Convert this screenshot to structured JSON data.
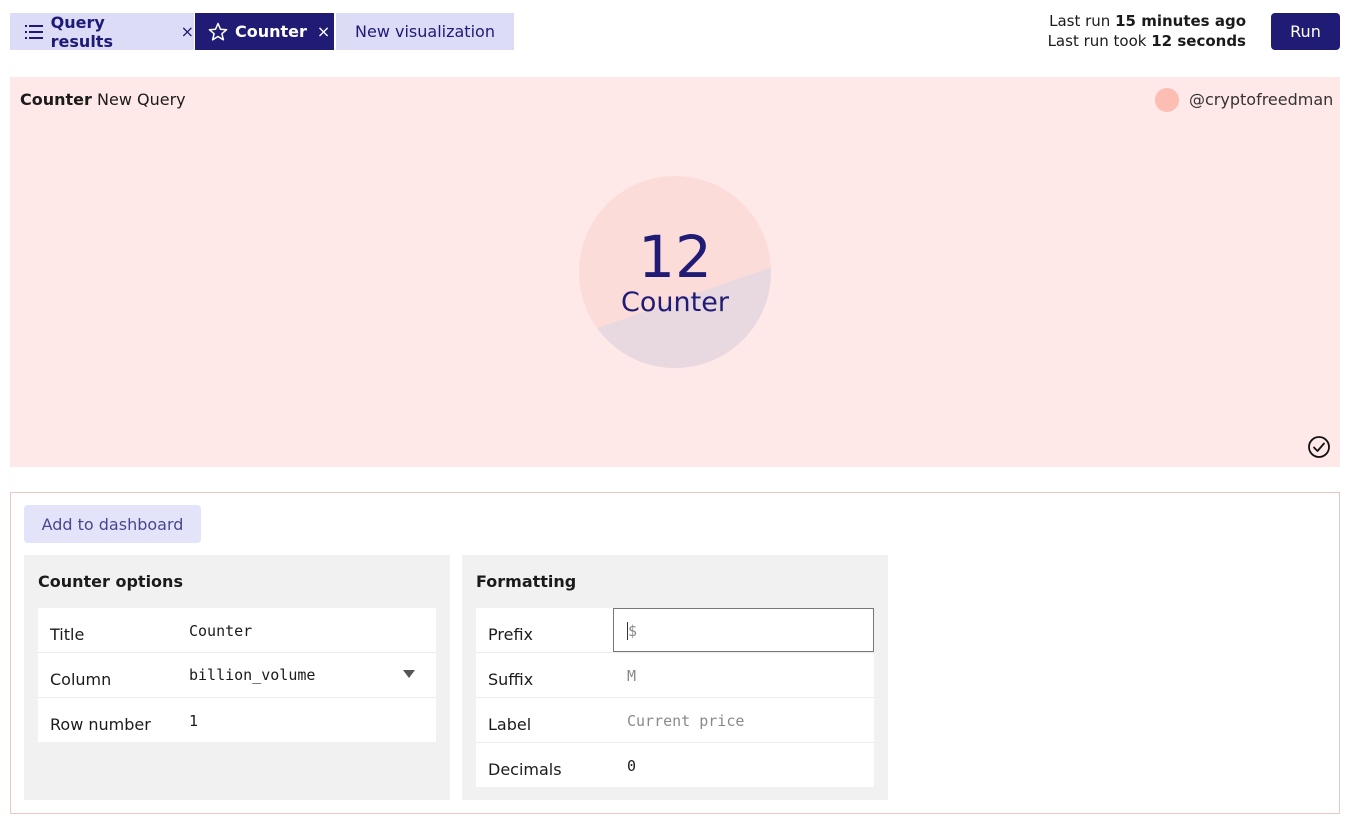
{
  "tabs": [
    {
      "label": "Query results",
      "icon": "list-icon",
      "closable": true
    },
    {
      "label": "Counter",
      "icon": "star-icon",
      "closable": true,
      "active": true
    },
    {
      "label": "New visualization",
      "closable": false
    }
  ],
  "tab_close_glyph": "×",
  "last_run": {
    "prefix1": "Last run",
    "value1": "15 minutes ago",
    "prefix2": "Last run took",
    "value2": "12 seconds"
  },
  "run_label": "Run",
  "viz": {
    "type": "Counter",
    "name": "New Query",
    "user": "@cryptofreedman",
    "counter_value": "12",
    "counter_label": "Counter"
  },
  "settings": {
    "add_to_dashboard": "Add to dashboard",
    "counter_options": {
      "title": "Counter options",
      "rows": [
        {
          "label": "Title",
          "value": "Counter"
        },
        {
          "label": "Column",
          "value": "billion_volume"
        },
        {
          "label": "Row number",
          "value": "1"
        }
      ]
    },
    "formatting": {
      "title": "Formatting",
      "rows": [
        {
          "label": "Prefix",
          "placeholder": "$"
        },
        {
          "label": "Suffix",
          "placeholder": "M"
        },
        {
          "label": "Label",
          "placeholder": "Current price"
        },
        {
          "label": "Decimals",
          "value": "0"
        }
      ]
    }
  },
  "colors": {
    "brand": "#201c76",
    "tab_inactive": "#dcdcf7",
    "viz_bg": "#ffe8e8",
    "avatar": "#fcbdb3"
  }
}
